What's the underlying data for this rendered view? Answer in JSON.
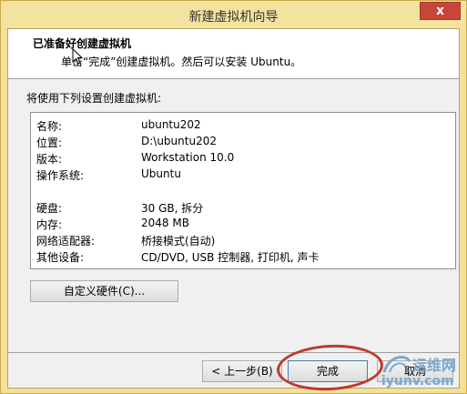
{
  "window": {
    "title": "新建虚拟机向导",
    "close_glyph": "x"
  },
  "header": {
    "title": "已准备好创建虚拟机",
    "subtitle": "单击“完成”创建虚拟机。然后可以安装 Ubuntu。"
  },
  "intro": "将使用下列设置创建虚拟机:",
  "settings": [
    {
      "key": "名称:",
      "value": "ubuntu202"
    },
    {
      "key": "位置:",
      "value": "D:\\ubuntu202"
    },
    {
      "key": "版本:",
      "value": "Workstation 10.0"
    },
    {
      "key": "操作系统:",
      "value": "Ubuntu"
    },
    {
      "key": "硬盘:",
      "value": "30 GB, 拆分"
    },
    {
      "key": "内存:",
      "value": "2048 MB"
    },
    {
      "key": "网络适配器:",
      "value": "桥接模式(自动)"
    },
    {
      "key": "其他设备:",
      "value": "CD/DVD, USB 控制器, 打印机, 声卡"
    }
  ],
  "buttons": {
    "customize": "自定义硬件(C)...",
    "back": "< 上一步(B)",
    "finish": "完成",
    "cancel": "取消"
  },
  "watermark": {
    "line1": "运维网",
    "line2": "iyunv.com"
  },
  "colors": {
    "highlight_oval": "#c0392b",
    "title_bg": "#f4e39e"
  }
}
